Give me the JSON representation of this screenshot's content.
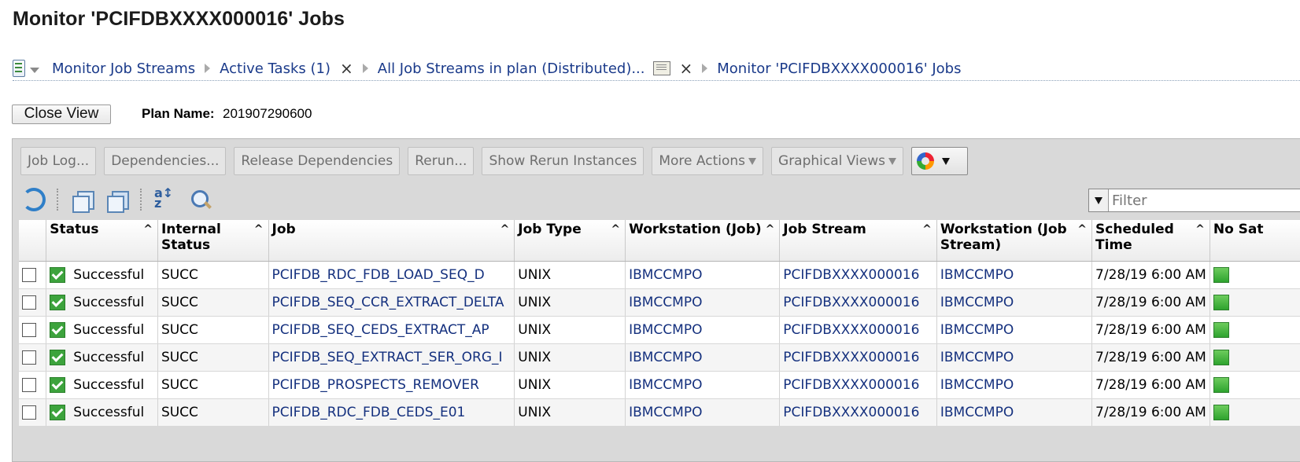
{
  "page_title": "Monitor 'PCIFDBXXXX000016' Jobs",
  "breadcrumb": {
    "items": [
      {
        "label": "Monitor Job Streams"
      },
      {
        "label": "Active Tasks (1)"
      },
      {
        "label": "All Job Streams in plan (Distributed)..."
      },
      {
        "label": "Monitor 'PCIFDBXXXX000016' Jobs"
      }
    ],
    "close_glyph": "×"
  },
  "close_view_label": "Close View",
  "plan": {
    "label": "Plan Name:",
    "value": "201907290600"
  },
  "toolbar": {
    "buttons": [
      "Job Log...",
      "Dependencies...",
      "Release Dependencies",
      "Rerun...",
      "Show Rerun Instances",
      "More Actions",
      "Graphical Views"
    ]
  },
  "filter": {
    "placeholder": "Filter"
  },
  "table": {
    "columns": [
      "Status",
      "Internal Status",
      "Job",
      "Job Type",
      "Workstation (Job)",
      "Job Stream",
      "Workstation (Job Stream)",
      "Scheduled Time",
      "No Sat"
    ],
    "sort_glyph": "^",
    "rows": [
      {
        "status": "Successful",
        "internal": "SUCC",
        "job": "PCIFDB_RDC_FDB_LOAD_SEQ_D",
        "type": "UNIX",
        "ws_job": "IBMCCMPO",
        "stream": "PCIFDBXXXX000016",
        "ws_stream": "IBMCCMPO",
        "time": "7/28/19 6:00 AM"
      },
      {
        "status": "Successful",
        "internal": "SUCC",
        "job": "PCIFDB_SEQ_CCR_EXTRACT_DELTA",
        "type": "UNIX",
        "ws_job": "IBMCCMPO",
        "stream": "PCIFDBXXXX000016",
        "ws_stream": "IBMCCMPO",
        "time": "7/28/19 6:00 AM"
      },
      {
        "status": "Successful",
        "internal": "SUCC",
        "job": "PCIFDB_SEQ_CEDS_EXTRACT_AP",
        "type": "UNIX",
        "ws_job": "IBMCCMPO",
        "stream": "PCIFDBXXXX000016",
        "ws_stream": "IBMCCMPO",
        "time": "7/28/19 6:00 AM"
      },
      {
        "status": "Successful",
        "internal": "SUCC",
        "job": "PCIFDB_SEQ_EXTRACT_SER_ORG_I",
        "type": "UNIX",
        "ws_job": "IBMCCMPO",
        "stream": "PCIFDBXXXX000016",
        "ws_stream": "IBMCCMPO",
        "time": "7/28/19 6:00 AM"
      },
      {
        "status": "Successful",
        "internal": "SUCC",
        "job": "PCIFDB_PROSPECTS_REMOVER",
        "type": "UNIX",
        "ws_job": "IBMCCMPO",
        "stream": "PCIFDBXXXX000016",
        "ws_stream": "IBMCCMPO",
        "time": "7/28/19 6:00 AM"
      },
      {
        "status": "Successful",
        "internal": "SUCC",
        "job": "PCIFDB_RDC_FDB_CEDS_E01",
        "type": "UNIX",
        "ws_job": "IBMCCMPO",
        "stream": "PCIFDBXXXX000016",
        "ws_stream": "IBMCCMPO",
        "time": "7/28/19 6:00 AM"
      }
    ]
  }
}
